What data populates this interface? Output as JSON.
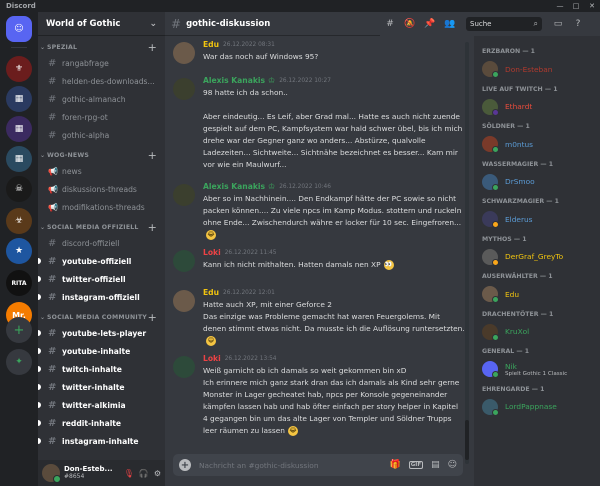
{
  "app": {
    "title": "Discord",
    "window_controls": [
      "—",
      "□",
      "✕"
    ]
  },
  "server_rail": {
    "servers": [
      {
        "name": "discord-home",
        "label": "",
        "color": "#5865f2",
        "glyph": "☺"
      },
      {
        "name": "server-gothic-rpg",
        "label": "",
        "color": "#6b1d1d",
        "glyph": "⚜"
      },
      {
        "name": "server-group-1",
        "label": "",
        "color": "#2a3a60",
        "glyph": "▦"
      },
      {
        "name": "server-group-2",
        "label": "",
        "color": "#3b2a60",
        "glyph": "▦"
      },
      {
        "name": "server-group-3",
        "label": "",
        "color": "#2a4a60",
        "glyph": "▦"
      },
      {
        "name": "server-skull",
        "label": "",
        "color": "#1a1a1a",
        "glyph": "☠"
      },
      {
        "name": "server-orange-mask",
        "label": "",
        "color": "#5a3a1a",
        "glyph": "☣"
      },
      {
        "name": "server-star",
        "label": "",
        "color": "#1e56a0",
        "glyph": "★"
      },
      {
        "name": "server-rita",
        "label": "RITA",
        "color": "#111111",
        "glyph": ""
      },
      {
        "name": "server-mr",
        "label": "Mr.",
        "color": "#f57c00",
        "glyph": ""
      }
    ],
    "add_label": "+",
    "explore_label": "✦"
  },
  "guild": {
    "name": "World of Gothic"
  },
  "categories": [
    {
      "label": "SPEZIAL",
      "channels": [
        {
          "label": "rangabfrage",
          "type": "text",
          "unread": false
        },
        {
          "label": "helden-des-downloads...",
          "type": "text",
          "unread": false
        },
        {
          "label": "gothic-almanach",
          "type": "text",
          "unread": false
        },
        {
          "label": "foren-rpg-ot",
          "type": "text",
          "unread": false
        },
        {
          "label": "gothic-alpha",
          "type": "text",
          "unread": false
        }
      ]
    },
    {
      "label": "WOG-NEWS",
      "channels": [
        {
          "label": "news",
          "type": "announce",
          "unread": false
        },
        {
          "label": "diskussions-threads",
          "type": "announce",
          "unread": false
        },
        {
          "label": "modifikations-threads",
          "type": "announce",
          "unread": false
        }
      ]
    },
    {
      "label": "SOCIAL MEDIA OFFIZIELL",
      "channels": [
        {
          "label": "discord-offiziell",
          "type": "text",
          "unread": false
        },
        {
          "label": "youtube-offiziell",
          "type": "text",
          "unread": true
        },
        {
          "label": "twitter-offiziell",
          "type": "text",
          "unread": true
        },
        {
          "label": "instagram-offiziell",
          "type": "text",
          "unread": true
        }
      ]
    },
    {
      "label": "SOCIAL MEDIA COMMUNITY",
      "channels": [
        {
          "label": "youtube-lets-player",
          "type": "text",
          "unread": true
        },
        {
          "label": "youtube-inhalte",
          "type": "text",
          "unread": true
        },
        {
          "label": "twitch-inhalte",
          "type": "text",
          "unread": true
        },
        {
          "label": "twitter-inhalte",
          "type": "text",
          "unread": true
        },
        {
          "label": "twitter-alkimia",
          "type": "text",
          "unread": true
        },
        {
          "label": "reddit-inhalte",
          "type": "text",
          "unread": true
        },
        {
          "label": "instagram-inhalte",
          "type": "text",
          "unread": true
        }
      ]
    }
  ],
  "user": {
    "name": "Don-Esteb...",
    "tag": "#8654"
  },
  "channel": {
    "name": "gothic-diskussion"
  },
  "search": {
    "placeholder": "Suche"
  },
  "messages": [
    {
      "author": "Edu",
      "color": "#f1c40f",
      "badge": "",
      "time": "26.12.2022 08:31",
      "text": "War das noch auf Windows 95?",
      "avatar": "#6b5a4a"
    },
    {
      "author": "Alexis Kanakis",
      "color": "#3ba55d",
      "badge": "♔",
      "time": "26.12.2022 10:27",
      "text": "98 hatte ich da schon..\n\nAber eindeutig... Es Leif, aber Grad mal... Hatte es auch nicht zuende gespielt auf dem PC, Kampfsystem war hald schwer übel, bis ich mich drehe war der Gegner ganz wo anders... Abstürze, qualvolle Ladezeiten... Sichtweite... Sichtnähe bezeichnet es besser... Kam mir vor wie ein Maulwurf...",
      "avatar": "#3b3f2e"
    },
    {
      "author": "Alexis Kanakis",
      "color": "#3ba55d",
      "badge": "♔",
      "time": "26.12.2022 10:46",
      "text": "Aber so im Nachhinein.... Den Endkampf hätte der PC sowie so nicht packen können.... Zu viele npcs im Kamp Modus. stottern und ruckeln ohne Ende... Zwischendurch währe er locker für 10 sec. Eingefroren...",
      "avatar": "#3b3f2e",
      "emoji": "😂"
    },
    {
      "author": "Loki",
      "color": "#ed4245",
      "badge": "",
      "time": "26.12.2022 11:45",
      "text": "Kann ich nicht mithalten. Hatten damals nen XP",
      "avatar": "#2d4a3a",
      "emoji": "👀"
    },
    {
      "author": "Edu",
      "color": "#f1c40f",
      "badge": "",
      "time": "26.12.2022 12:01",
      "text": "Hatte auch XP, mit einer Geforce 2\nDas einzige was Probleme gemacht hat waren Feuergolems. Mit denen stimmt etwas nicht. Da musste ich die Auflösung runtersetzten.",
      "avatar": "#6b5a4a",
      "emoji": "😄"
    },
    {
      "author": "Loki",
      "color": "#ed4245",
      "badge": "",
      "time": "26.12.2022 13:54",
      "text": "Weiß garnicht ob ich damals so weit gekommen bin xD\nIch erinnere mich ganz stark dran das ich damals als Kind sehr gerne Monster in Lager gecheatet hab, npcs per Konsole gegeneinander kämpfen lassen hab und hab öfter einfach per story helper in Kapitel 4 gegangen bin um das alte Lager von Templer und Söldner Trupps leer räumen zu lassen",
      "avatar": "#2d4a3a",
      "emoji": "😂"
    }
  ],
  "composer": {
    "placeholder": "Nachricht an #gothic-diskussion"
  },
  "member_roles": [
    {
      "role": "ERZBARON — 1",
      "name": "Don-Esteban",
      "color": "#b03a2e",
      "status": "#3ba55d",
      "avatar": "#5a4b3c"
    },
    {
      "role": "LIVE AUF TWITCH — 1",
      "name": "Ethardt",
      "color": "#e74c3c",
      "status": "#593695",
      "avatar": "#4a5a3a"
    },
    {
      "role": "SÖLDNER — 1",
      "name": "m0ntus",
      "color": "#5b9bd5",
      "status": "#3ba55d",
      "avatar": "#7a3a2a"
    },
    {
      "role": "WASSERMAGIER — 1",
      "name": "DrSmoo",
      "color": "#5b9bd5",
      "status": "#3ba55d",
      "avatar": "#3a5a7a"
    },
    {
      "role": "SCHWARZMAGIER — 1",
      "name": "Elderus",
      "color": "#5b9bd5",
      "status": "#faa61a",
      "avatar": "#3a3a5a"
    },
    {
      "role": "MYTHOS — 1",
      "name": "DerGraf_GreyTo",
      "color": "#f1c40f",
      "status": "#faa61a",
      "avatar": "#5a5a5a"
    },
    {
      "role": "AUSERWÄHLTER — 1",
      "name": "Edu",
      "color": "#f1c40f",
      "status": "#3ba55d",
      "avatar": "#6b5a4a"
    },
    {
      "role": "DRACHENTÖTER — 1",
      "name": "KruXol",
      "color": "#3ba55d",
      "status": "#3ba55d",
      "avatar": "#4a3a2a"
    },
    {
      "role": "GENERAL — 1",
      "name": "Nik",
      "color": "#3ba55d",
      "status": "#3ba55d",
      "avatar": "#5865f2",
      "activity": "Spielt Gothic 1 Classic"
    },
    {
      "role": "EHRENGARDE — 1",
      "name": "LordPappnase",
      "color": "#3ba55d",
      "status": "#3ba55d",
      "avatar": "#3a5a6a"
    }
  ]
}
